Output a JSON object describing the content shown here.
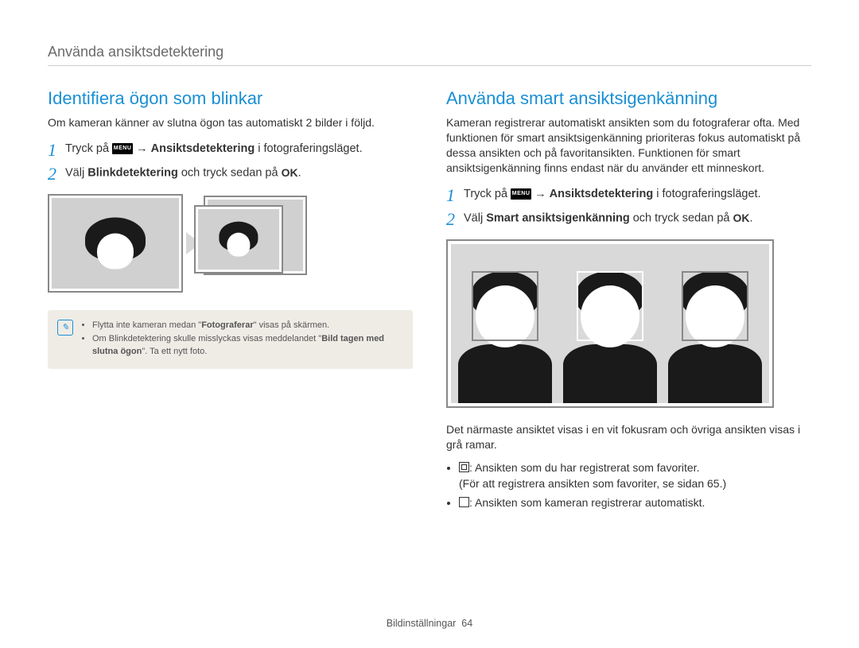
{
  "header": {
    "title": "Använda ansiktsdetektering"
  },
  "left": {
    "heading": "Identifiera ögon som blinkar",
    "intro": "Om kameran känner av slutna ögon tas automatiskt 2 bilder i följd.",
    "steps": [
      {
        "num": "1",
        "prefix": "Tryck på ",
        "menu_label": "MENU",
        "arrow": " → ",
        "bold": "Ansiktsdetektering",
        "suffix": " i fotograferingsläget."
      },
      {
        "num": "2",
        "prefix": "Välj ",
        "bold": "Blinkdetektering",
        "mid": " och tryck sedan på ",
        "ok": "OK",
        "suffix": "."
      }
    ],
    "note_icon": "✎",
    "notes": [
      {
        "pre": "Flytta inte kameran medan \"",
        "bold": "Fotograferar",
        "post": "\" visas på skärmen."
      },
      {
        "pre": "Om Blinkdetektering skulle misslyckas visas meddelandet \"",
        "bold": "Bild tagen med slutna ögon",
        "post": "\". Ta ett nytt foto."
      }
    ]
  },
  "right": {
    "heading": "Använda smart ansiktsigenkänning",
    "intro": "Kameran registrerar automatiskt ansikten som du fotograferar ofta. Med funktionen för smart ansiktsigenkänning prioriteras fokus automatiskt på dessa ansikten och på favoritansikten. Funktionen för smart ansiktsigenkänning finns endast när du använder ett minneskort.",
    "steps": [
      {
        "num": "1",
        "prefix": "Tryck på ",
        "menu_label": "MENU",
        "arrow": " → ",
        "bold": "Ansiktsdetektering",
        "suffix": " i fotograferingsläget."
      },
      {
        "num": "2",
        "prefix": "Välj ",
        "bold": "Smart ansiktsigenkänning",
        "mid": " och tryck sedan på ",
        "ok": "OK",
        "suffix": "."
      }
    ],
    "caption": "Det närmaste ansiktet visas i en vit fokusram och övriga ansikten visas i grå ramar.",
    "bullets": [
      {
        "icon": "double",
        "text_a": ": Ansikten som du har registrerat som favoriter.",
        "text_b": "(För att registrera ansikten som favoriter, se sidan 65.)"
      },
      {
        "icon": "single",
        "text_a": ": Ansikten som kameran registrerar automatiskt.",
        "text_b": ""
      }
    ]
  },
  "footer": {
    "section": "Bildinställningar",
    "page": "64"
  }
}
